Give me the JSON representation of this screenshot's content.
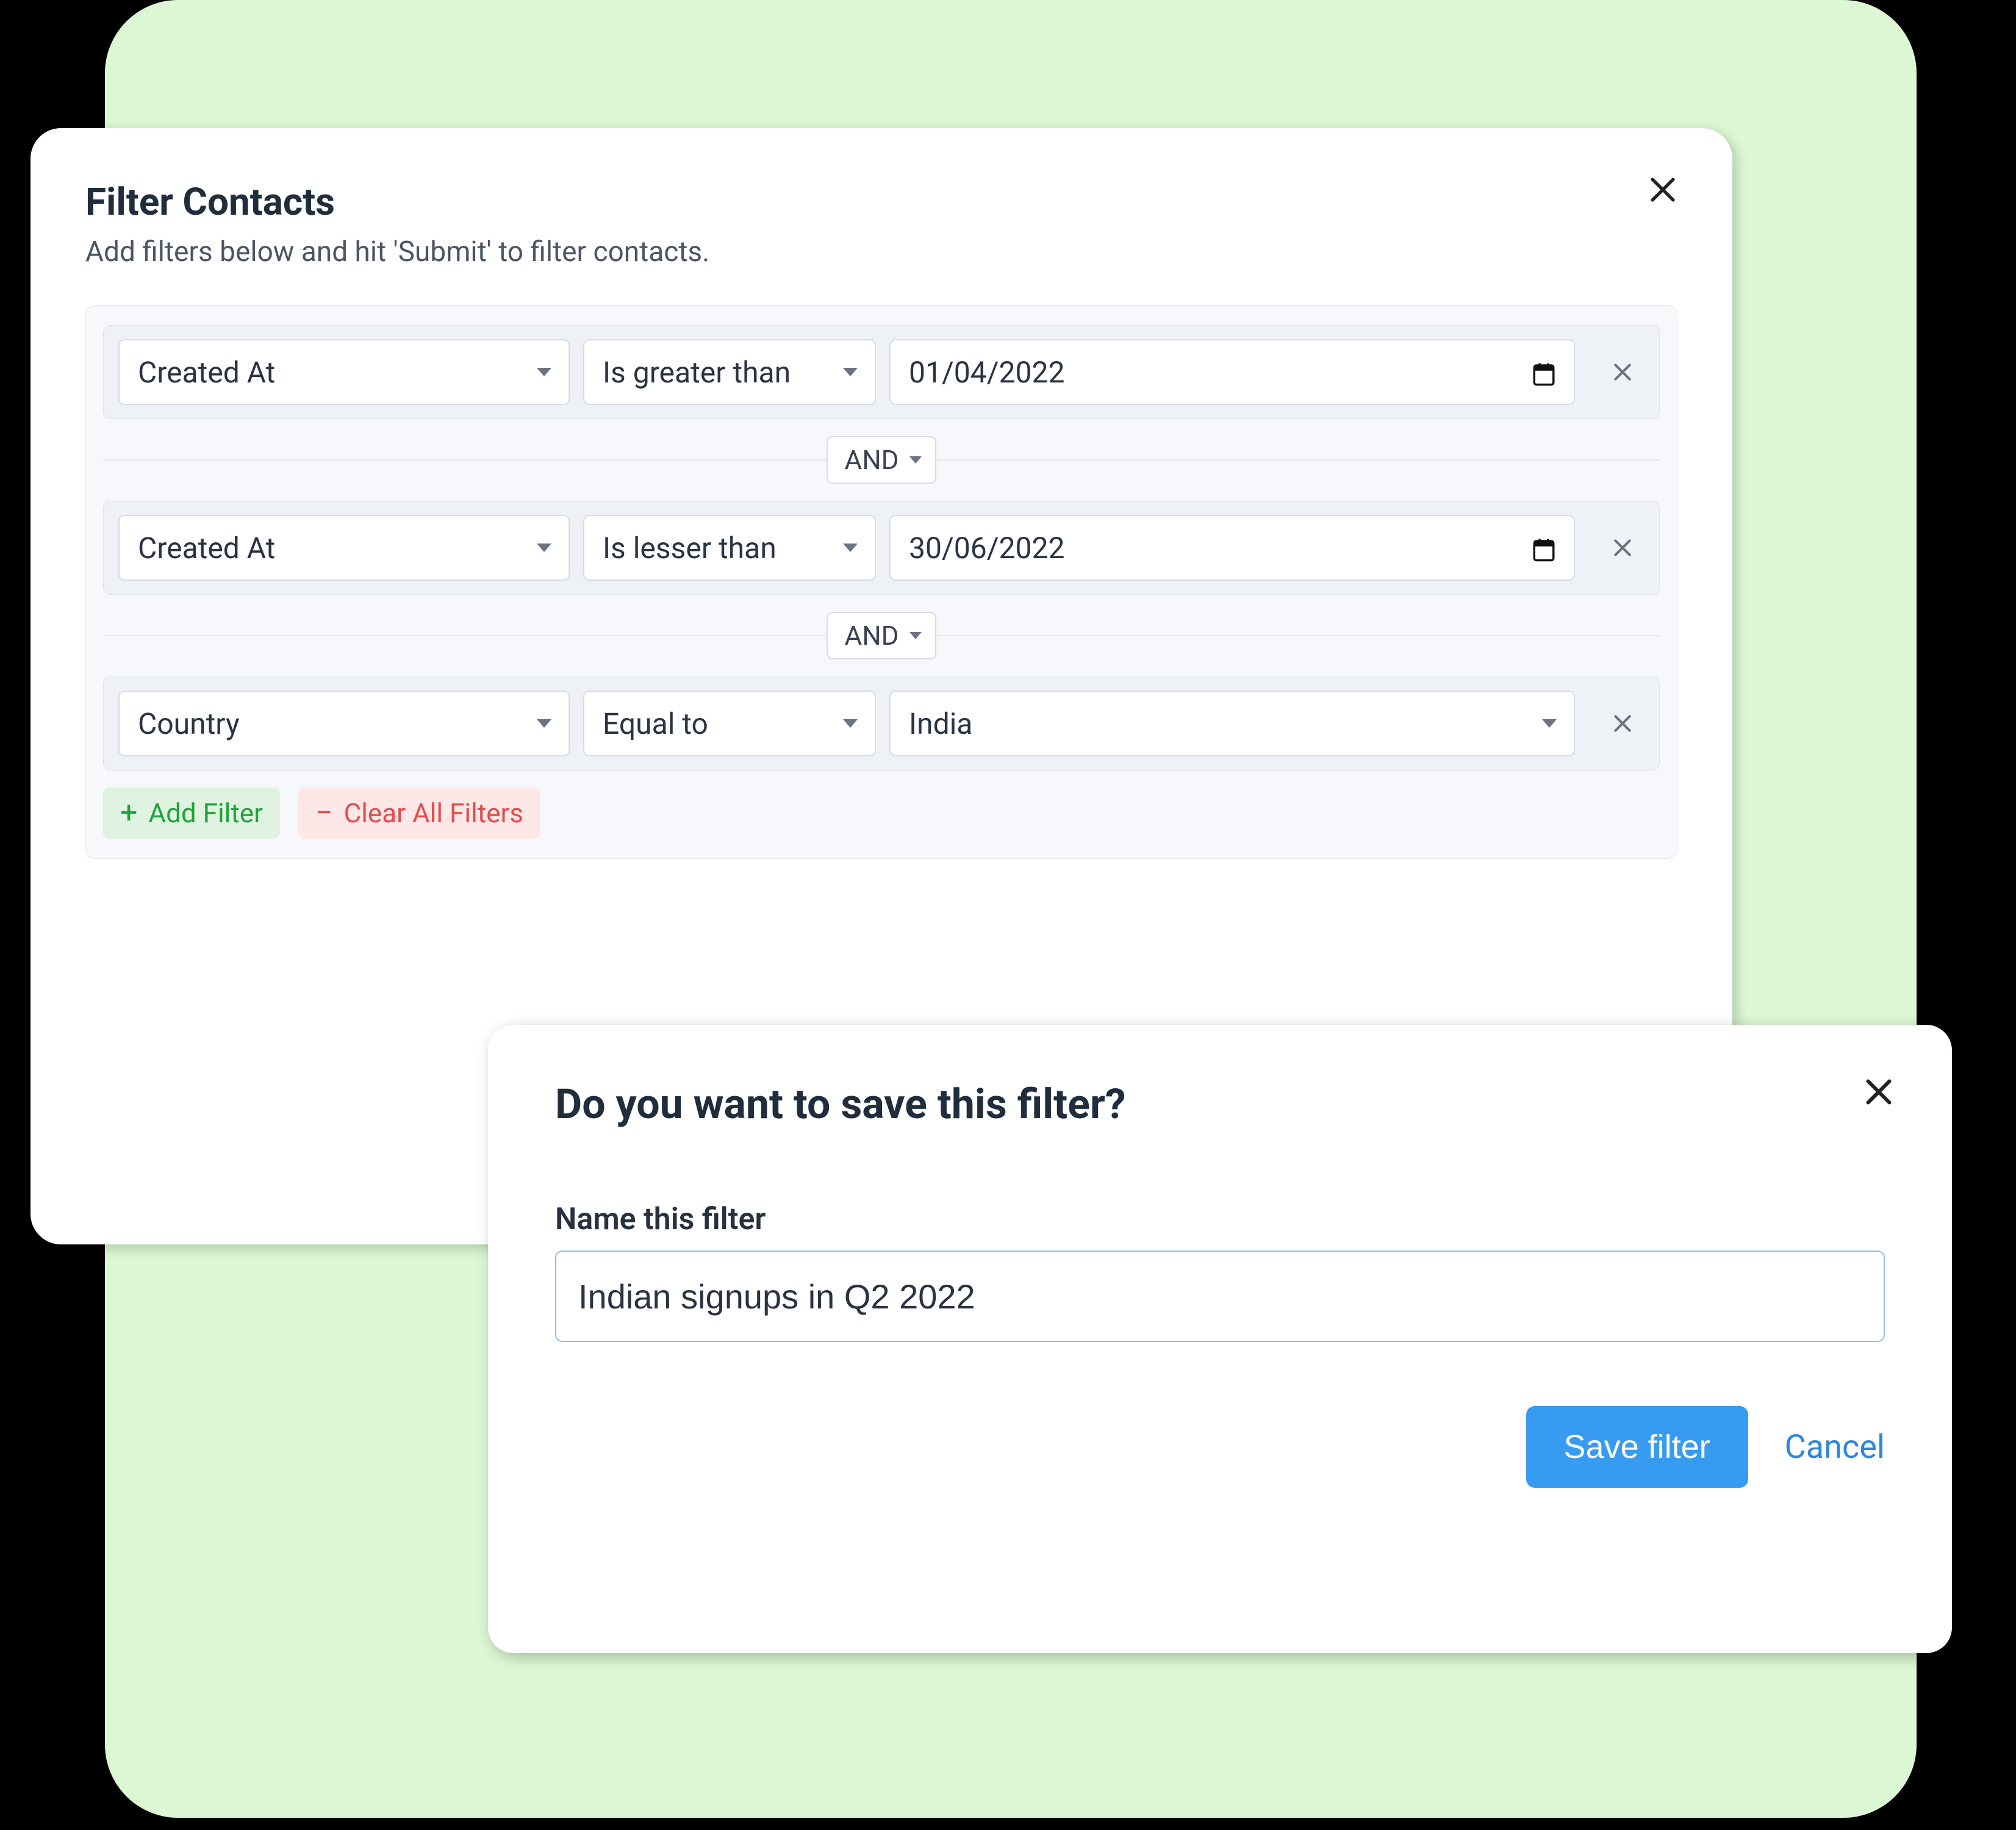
{
  "filterPanel": {
    "title": "Filter Contacts",
    "subtitle": "Add filters below and hit 'Submit' to filter contacts.",
    "rows": [
      {
        "field": "Created At",
        "op": "Is greater than",
        "value": "01/04/2022",
        "valueType": "date"
      },
      {
        "field": "Created At",
        "op": "Is lesser than",
        "value": "30/06/2022",
        "valueType": "date"
      },
      {
        "field": "Country",
        "op": "Equal to",
        "value": "India",
        "valueType": "select"
      }
    ],
    "connectors": [
      {
        "label": "AND"
      },
      {
        "label": "AND"
      }
    ],
    "actions": {
      "add": "Add Filter",
      "clear": "Clear All Filters"
    }
  },
  "saveModal": {
    "title": "Do you want to save this filter?",
    "label": "Name this filter",
    "value": "Indian signups in Q2 2022",
    "save": "Save filter",
    "cancel": "Cancel"
  }
}
